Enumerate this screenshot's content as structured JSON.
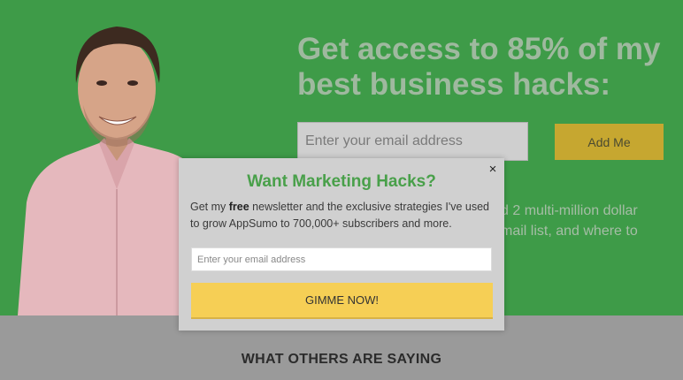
{
  "hero": {
    "headline": "Get access to 85% of my best business hacks:",
    "email_placeholder": "Enter your email address",
    "add_button": "Add Me",
    "body_line1": "d 2 multi-million dollar",
    "body_line2": "mail list, and where to"
  },
  "modal": {
    "close": "×",
    "title": "Want Marketing Hacks?",
    "text_before": "Get my ",
    "text_bold": "free",
    "text_after": " newsletter and the exclusive strategies I've used to grow AppSumo to 700,000+ subscribers and more.",
    "email_placeholder": "Enter your email address",
    "submit": "GIMME NOW!"
  },
  "testimonials": {
    "heading": "WHAT OTHERS ARE SAYING"
  },
  "colors": {
    "hero_bg": "#3e9b48",
    "title_green": "#49a04a",
    "submit_yellow": "#f6cf55"
  }
}
